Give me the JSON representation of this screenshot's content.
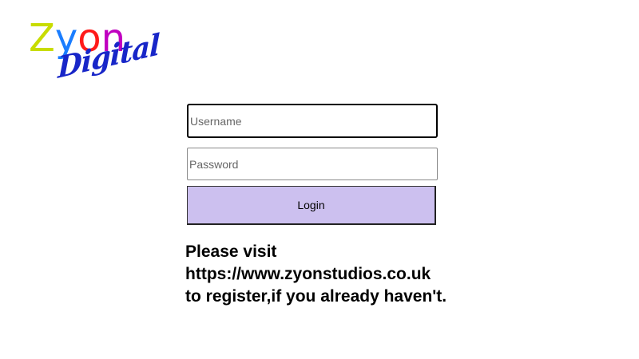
{
  "logo": {
    "letters": [
      {
        "char": "Z",
        "color": "#c8dc00"
      },
      {
        "char": "y",
        "color": "#1a7dff"
      },
      {
        "char": "o",
        "color": "#ff1a1a"
      },
      {
        "char": "n",
        "color": "#c000c0"
      }
    ],
    "subtitle": "Digital",
    "subtitle_color": "#1826c8"
  },
  "form": {
    "username": {
      "placeholder": "Username",
      "value": ""
    },
    "password": {
      "placeholder": "Password",
      "value": ""
    },
    "login_label": "Login",
    "login_color": "#ccc0ef"
  },
  "notice": {
    "lines": [
      "Please visit",
      "https://www.zyonstudios.co.uk",
      "to register,if you already haven't."
    ]
  }
}
